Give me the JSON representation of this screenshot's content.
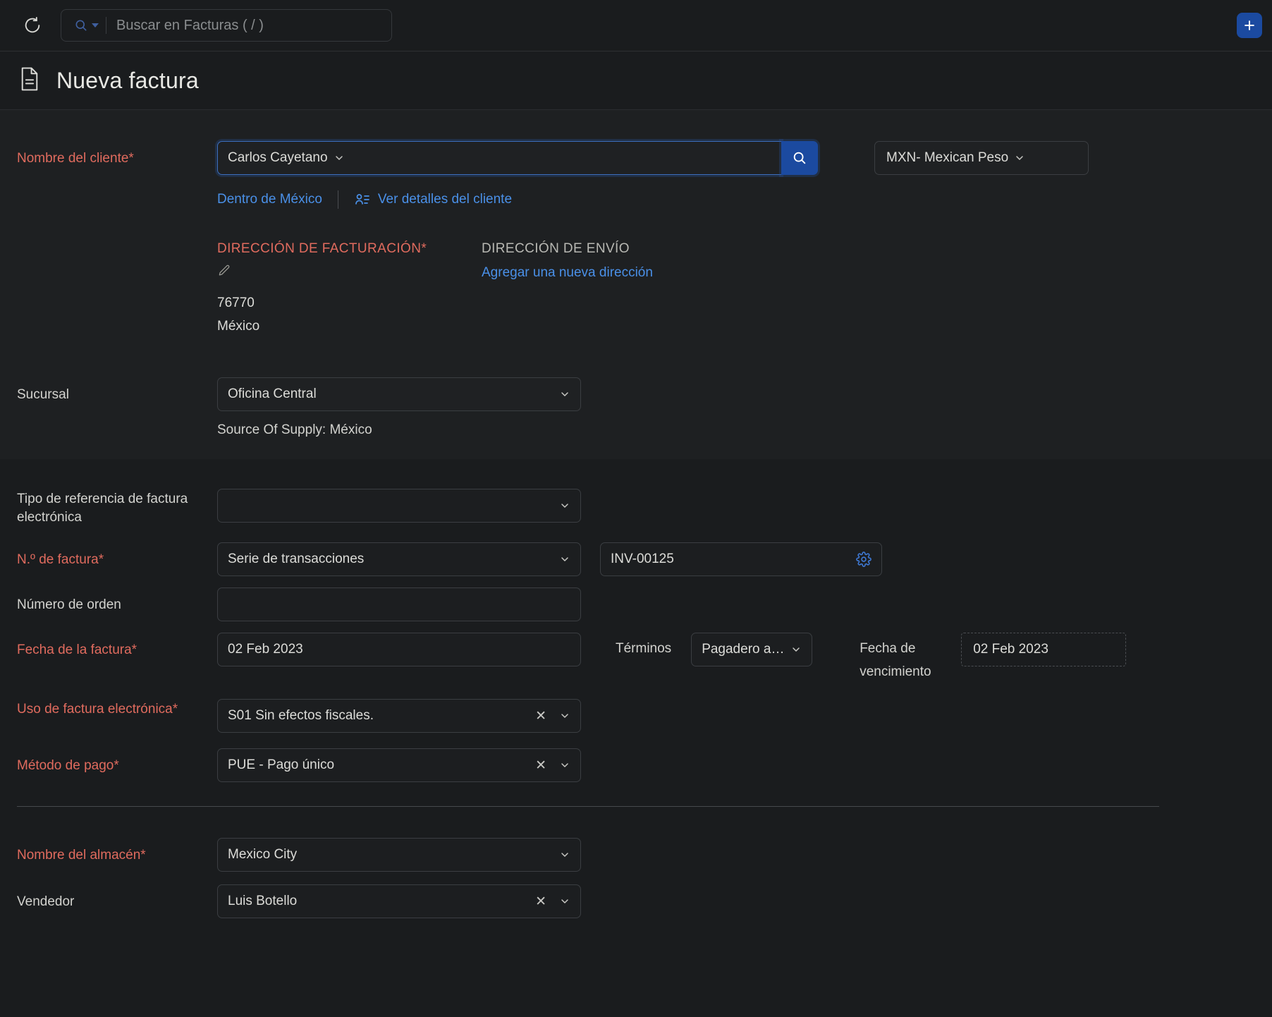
{
  "topbar": {
    "refresh_icon": "refresh-clock-icon",
    "search_icon": "search-icon",
    "search_dropdown_icon": "caret-down-icon",
    "search_placeholder": "Buscar en Facturas ( / )",
    "search_value": "",
    "add_button_icon": "plus-icon",
    "accent": "#1b4aa0"
  },
  "header": {
    "doc_icon": "document-icon",
    "title": "Nueva factura"
  },
  "customer": {
    "label": "Nombre del cliente*",
    "value": "Carlos Cayetano",
    "dropdown_icon": "chevron-down-icon",
    "search_button_icon": "search-icon",
    "currency": "MXN- Mexican Peso",
    "currency_icon": "chevron-down-icon",
    "link_region": "Dentro de México",
    "link_details": "Ver detalles del cliente",
    "details_icon": "contact-card-icon"
  },
  "address": {
    "billing_heading": "DIRECCIÓN DE FACTURACIÓN*",
    "billing_edit_icon": "pencil-icon",
    "billing_lines": [
      "76770",
      "México"
    ],
    "shipping_heading": "DIRECCIÓN DE ENVÍO",
    "shipping_add_link": "Agregar una nueva dirección"
  },
  "branch": {
    "label": "Sucursal",
    "value": "Oficina Central",
    "icon": "chevron-down-icon",
    "source_of_supply": "Source Of Supply: México"
  },
  "einvoice_ref": {
    "label": "Tipo de referencia de factura electrónica",
    "value": "",
    "icon": "chevron-down-icon"
  },
  "invoice_no": {
    "label": "N.º de factura*",
    "series_value": "Serie de transacciones",
    "series_icon": "chevron-down-icon",
    "number_value": "INV-00125",
    "settings_icon": "gear-icon"
  },
  "order_no": {
    "label": "Número de orden",
    "value": ""
  },
  "invoice_date": {
    "label": "Fecha de la factura*",
    "value": "02 Feb 2023",
    "terms_label": "Términos",
    "terms_value": "Pagadero a la...",
    "terms_icon": "chevron-down-icon",
    "due_label": "Fecha de vencimiento",
    "due_value": "02 Feb 2023"
  },
  "einvoice_use": {
    "label": "Uso de factura electrónica*",
    "value": "S01 Sin efectos fiscales.",
    "clear_icon": "clear-x-icon",
    "icon": "chevron-down-icon"
  },
  "payment_method": {
    "label": "Método de pago*",
    "value": "PUE - Pago único",
    "clear_icon": "clear-x-icon",
    "icon": "chevron-down-icon"
  },
  "warehouse": {
    "label": "Nombre del almacén*",
    "value": "Mexico City",
    "icon": "chevron-down-icon"
  },
  "salesperson": {
    "label": "Vendedor",
    "value": "Luis Botello",
    "clear_icon": "clear-x-icon",
    "icon": "chevron-down-icon"
  },
  "colors": {
    "required_red": "#e06b5e",
    "link_blue": "#4a90e8",
    "accent_blue": "#1b4aa0",
    "bg_dark": "#1a1c1e",
    "bg_panel": "#1e2022"
  }
}
